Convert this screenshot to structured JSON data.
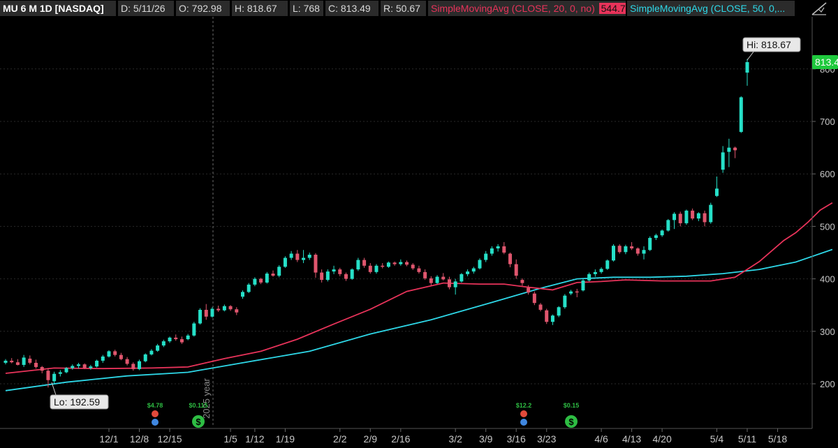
{
  "header": {
    "symbol_label": "MU 6 M 1D [NASDAQ]",
    "date_label": "D: 5/11/26",
    "open_label": "O: 792.98",
    "high_label": "H: 818.67",
    "low_label": "L: 768",
    "close_label": "C: 813.49",
    "rsi_label": "R: 50.67",
    "sma20_label": "SimpleMovingAvg (CLOSE, 20, 0, no)",
    "sma20_value": "544.74",
    "sma50_label": "SimpleMovingAvg (CLOSE, 50, 0,..."
  },
  "colors": {
    "up": "#26e0c8",
    "down": "#e0566e",
    "sma20": "#e8335a",
    "sma50": "#2ed8e8",
    "price_tag": "#1fc93d",
    "grid": "#2a2a2a",
    "axis_text": "#c8c8c8",
    "earnings": "#e24a3b",
    "dividend": "#2ebd43",
    "info": "#3f87e0"
  },
  "chart_data": {
    "type": "candlestick",
    "symbol": "MU",
    "timeframe": "6 M 1D",
    "exchange": "NASDAQ",
    "ylim": [
      160,
      835
    ],
    "y_ticks": [
      200,
      300,
      400,
      500,
      600,
      700,
      800
    ],
    "x_ticks": [
      "12/1",
      "12/8",
      "12/15",
      "1/5",
      "1/12",
      "1/19",
      "2/2",
      "2/9",
      "2/16",
      "3/2",
      "3/9",
      "3/16",
      "3/23",
      "4/6",
      "4/13",
      "4/20",
      "5/4",
      "5/11",
      "5/18"
    ],
    "year_marker": "2025 year",
    "last_price_tag": "813.4",
    "high_label": "Hi: 818.67",
    "low_label": "Lo: 192.59",
    "candles": [
      {
        "o": 240,
        "h": 247,
        "l": 237,
        "c": 244
      },
      {
        "o": 244,
        "h": 249,
        "l": 239,
        "c": 241
      },
      {
        "o": 241,
        "h": 247,
        "l": 235,
        "c": 236
      },
      {
        "o": 236,
        "h": 255,
        "l": 232,
        "c": 250
      },
      {
        "o": 248,
        "h": 254,
        "l": 237,
        "c": 240
      },
      {
        "o": 240,
        "h": 246,
        "l": 229,
        "c": 232
      },
      {
        "o": 232,
        "h": 234,
        "l": 220,
        "c": 225
      },
      {
        "o": 225,
        "h": 230,
        "l": 193,
        "c": 207
      },
      {
        "o": 205,
        "h": 223,
        "l": 199,
        "c": 219
      },
      {
        "o": 219,
        "h": 226,
        "l": 214,
        "c": 222
      },
      {
        "o": 222,
        "h": 232,
        "l": 220,
        "c": 230
      },
      {
        "o": 230,
        "h": 237,
        "l": 227,
        "c": 234
      },
      {
        "o": 234,
        "h": 240,
        "l": 229,
        "c": 237
      },
      {
        "o": 237,
        "h": 239,
        "l": 228,
        "c": 230
      },
      {
        "o": 230,
        "h": 236,
        "l": 227,
        "c": 233
      },
      {
        "o": 233,
        "h": 246,
        "l": 231,
        "c": 244
      },
      {
        "o": 244,
        "h": 255,
        "l": 240,
        "c": 252
      },
      {
        "o": 252,
        "h": 264,
        "l": 250,
        "c": 262
      },
      {
        "o": 262,
        "h": 265,
        "l": 252,
        "c": 255
      },
      {
        "o": 255,
        "h": 259,
        "l": 245,
        "c": 247
      },
      {
        "o": 247,
        "h": 251,
        "l": 235,
        "c": 238
      },
      {
        "o": 238,
        "h": 241,
        "l": 225,
        "c": 228
      },
      {
        "o": 228,
        "h": 246,
        "l": 226,
        "c": 243
      },
      {
        "o": 243,
        "h": 258,
        "l": 241,
        "c": 256
      },
      {
        "o": 256,
        "h": 266,
        "l": 254,
        "c": 263
      },
      {
        "o": 263,
        "h": 276,
        "l": 261,
        "c": 273
      },
      {
        "o": 273,
        "h": 284,
        "l": 270,
        "c": 281
      },
      {
        "o": 281,
        "h": 290,
        "l": 278,
        "c": 288
      },
      {
        "o": 288,
        "h": 294,
        "l": 282,
        "c": 285
      },
      {
        "o": 285,
        "h": 290,
        "l": 276,
        "c": 279
      },
      {
        "o": 285,
        "h": 295,
        "l": 283,
        "c": 292
      },
      {
        "o": 292,
        "h": 318,
        "l": 290,
        "c": 315
      },
      {
        "o": 315,
        "h": 344,
        "l": 313,
        "c": 341
      },
      {
        "o": 341,
        "h": 352,
        "l": 322,
        "c": 328
      },
      {
        "o": 328,
        "h": 346,
        "l": 326,
        "c": 343
      },
      {
        "o": 343,
        "h": 349,
        "l": 337,
        "c": 340
      },
      {
        "o": 340,
        "h": 351,
        "l": 338,
        "c": 348
      },
      {
        "o": 348,
        "h": 350,
        "l": 339,
        "c": 342
      },
      {
        "o": 342,
        "h": 346,
        "l": 331,
        "c": 336
      },
      {
        "o": 366,
        "h": 378,
        "l": 362,
        "c": 375
      },
      {
        "o": 375,
        "h": 392,
        "l": 373,
        "c": 389
      },
      {
        "o": 389,
        "h": 403,
        "l": 386,
        "c": 400
      },
      {
        "o": 400,
        "h": 402,
        "l": 390,
        "c": 393
      },
      {
        "o": 393,
        "h": 413,
        "l": 391,
        "c": 410
      },
      {
        "o": 410,
        "h": 416,
        "l": 404,
        "c": 406
      },
      {
        "o": 406,
        "h": 426,
        "l": 403,
        "c": 423
      },
      {
        "o": 423,
        "h": 443,
        "l": 421,
        "c": 440
      },
      {
        "o": 440,
        "h": 453,
        "l": 436,
        "c": 448
      },
      {
        "o": 448,
        "h": 455,
        "l": 432,
        "c": 436
      },
      {
        "o": 436,
        "h": 455,
        "l": 430,
        "c": 440
      },
      {
        "o": 440,
        "h": 450,
        "l": 436,
        "c": 446
      },
      {
        "o": 446,
        "h": 449,
        "l": 402,
        "c": 412
      },
      {
        "o": 412,
        "h": 418,
        "l": 393,
        "c": 398
      },
      {
        "o": 398,
        "h": 418,
        "l": 395,
        "c": 414
      },
      {
        "o": 414,
        "h": 425,
        "l": 409,
        "c": 418
      },
      {
        "o": 418,
        "h": 421,
        "l": 405,
        "c": 409
      },
      {
        "o": 409,
        "h": 412,
        "l": 396,
        "c": 400
      },
      {
        "o": 400,
        "h": 420,
        "l": 398,
        "c": 418
      },
      {
        "o": 418,
        "h": 440,
        "l": 415,
        "c": 436
      },
      {
        "o": 436,
        "h": 440,
        "l": 421,
        "c": 425
      },
      {
        "o": 425,
        "h": 430,
        "l": 410,
        "c": 413
      },
      {
        "o": 413,
        "h": 428,
        "l": 410,
        "c": 425
      },
      {
        "o": 425,
        "h": 430,
        "l": 420,
        "c": 423
      },
      {
        "o": 423,
        "h": 433,
        "l": 421,
        "c": 431
      },
      {
        "o": 431,
        "h": 433,
        "l": 425,
        "c": 428
      },
      {
        "o": 428,
        "h": 437,
        "l": 425,
        "c": 432
      },
      {
        "o": 432,
        "h": 435,
        "l": 424,
        "c": 427
      },
      {
        "o": 427,
        "h": 430,
        "l": 417,
        "c": 420
      },
      {
        "o": 420,
        "h": 425,
        "l": 410,
        "c": 413
      },
      {
        "o": 413,
        "h": 418,
        "l": 398,
        "c": 401
      },
      {
        "o": 401,
        "h": 405,
        "l": 387,
        "c": 392
      },
      {
        "o": 392,
        "h": 407,
        "l": 390,
        "c": 404
      },
      {
        "o": 404,
        "h": 411,
        "l": 397,
        "c": 399
      },
      {
        "o": 399,
        "h": 404,
        "l": 380,
        "c": 384
      },
      {
        "o": 384,
        "h": 400,
        "l": 370,
        "c": 395
      },
      {
        "o": 395,
        "h": 411,
        "l": 393,
        "c": 409
      },
      {
        "o": 409,
        "h": 418,
        "l": 405,
        "c": 414
      },
      {
        "o": 414,
        "h": 423,
        "l": 410,
        "c": 420
      },
      {
        "o": 420,
        "h": 439,
        "l": 418,
        "c": 436
      },
      {
        "o": 436,
        "h": 453,
        "l": 432,
        "c": 448
      },
      {
        "o": 448,
        "h": 462,
        "l": 444,
        "c": 458
      },
      {
        "o": 458,
        "h": 466,
        "l": 452,
        "c": 462
      },
      {
        "o": 462,
        "h": 470,
        "l": 447,
        "c": 450
      },
      {
        "o": 448,
        "h": 450,
        "l": 422,
        "c": 428
      },
      {
        "o": 428,
        "h": 437,
        "l": 400,
        "c": 406
      },
      {
        "o": 398,
        "h": 401,
        "l": 387,
        "c": 392
      },
      {
        "o": 383,
        "h": 388,
        "l": 370,
        "c": 374
      },
      {
        "o": 372,
        "h": 376,
        "l": 350,
        "c": 354
      },
      {
        "o": 351,
        "h": 354,
        "l": 338,
        "c": 341
      },
      {
        "o": 340,
        "h": 343,
        "l": 314,
        "c": 318
      },
      {
        "o": 318,
        "h": 332,
        "l": 312,
        "c": 330
      },
      {
        "o": 330,
        "h": 348,
        "l": 327,
        "c": 346
      },
      {
        "o": 346,
        "h": 371,
        "l": 343,
        "c": 368
      },
      {
        "o": 372,
        "h": 379,
        "l": 369,
        "c": 376
      },
      {
        "o": 376,
        "h": 381,
        "l": 365,
        "c": 374
      },
      {
        "o": 378,
        "h": 400,
        "l": 376,
        "c": 397
      },
      {
        "o": 397,
        "h": 412,
        "l": 395,
        "c": 409
      },
      {
        "o": 409,
        "h": 418,
        "l": 404,
        "c": 413
      },
      {
        "o": 413,
        "h": 422,
        "l": 410,
        "c": 419
      },
      {
        "o": 419,
        "h": 437,
        "l": 417,
        "c": 435
      },
      {
        "o": 435,
        "h": 466,
        "l": 433,
        "c": 463
      },
      {
        "o": 463,
        "h": 466,
        "l": 448,
        "c": 451
      },
      {
        "o": 451,
        "h": 465,
        "l": 447,
        "c": 462
      },
      {
        "o": 462,
        "h": 470,
        "l": 455,
        "c": 458
      },
      {
        "o": 458,
        "h": 460,
        "l": 444,
        "c": 448
      },
      {
        "o": 448,
        "h": 462,
        "l": 437,
        "c": 455
      },
      {
        "o": 455,
        "h": 481,
        "l": 453,
        "c": 478
      },
      {
        "o": 478,
        "h": 486,
        "l": 474,
        "c": 483
      },
      {
        "o": 483,
        "h": 494,
        "l": 480,
        "c": 492
      },
      {
        "o": 492,
        "h": 514,
        "l": 490,
        "c": 512
      },
      {
        "o": 512,
        "h": 527,
        "l": 495,
        "c": 524
      },
      {
        "o": 524,
        "h": 528,
        "l": 500,
        "c": 506
      },
      {
        "o": 506,
        "h": 532,
        "l": 503,
        "c": 530
      },
      {
        "o": 530,
        "h": 534,
        "l": 512,
        "c": 515
      },
      {
        "o": 515,
        "h": 527,
        "l": 510,
        "c": 525
      },
      {
        "o": 525,
        "h": 530,
        "l": 500,
        "c": 508
      },
      {
        "o": 508,
        "h": 545,
        "l": 505,
        "c": 541
      },
      {
        "o": 558,
        "h": 595,
        "l": 556,
        "c": 572
      },
      {
        "o": 608,
        "h": 653,
        "l": 602,
        "c": 641
      },
      {
        "o": 642,
        "h": 667,
        "l": 613,
        "c": 650
      },
      {
        "o": 650,
        "h": 652,
        "l": 630,
        "c": 645
      },
      {
        "o": 680,
        "h": 748,
        "l": 678,
        "c": 746
      },
      {
        "o": 793,
        "h": 819,
        "l": 768,
        "c": 813
      }
    ],
    "series": [
      {
        "name": "SimpleMovingAvg (CLOSE, 20, 0, no)",
        "type": "line",
        "points": [
          [
            0,
            220
          ],
          [
            8,
            230
          ],
          [
            16,
            229
          ],
          [
            24,
            230
          ],
          [
            30,
            232
          ],
          [
            36,
            248
          ],
          [
            42,
            262
          ],
          [
            48,
            285
          ],
          [
            54,
            314
          ],
          [
            60,
            342
          ],
          [
            66,
            376
          ],
          [
            72,
            392
          ],
          [
            78,
            390
          ],
          [
            82,
            390
          ],
          [
            86,
            384
          ],
          [
            90,
            379
          ],
          [
            94,
            393
          ],
          [
            98,
            395
          ],
          [
            102,
            398
          ],
          [
            108,
            396
          ],
          [
            116,
            396
          ],
          [
            120,
            403
          ],
          [
            124,
            433
          ],
          [
            128,
            473
          ],
          [
            130,
            488
          ],
          [
            132,
            508
          ],
          [
            134,
            531
          ],
          [
            136,
            545
          ]
        ]
      },
      {
        "name": "SimpleMovingAvg (CLOSE, 50, 0,...",
        "type": "line",
        "points": [
          [
            0,
            187
          ],
          [
            10,
            203
          ],
          [
            20,
            215
          ],
          [
            30,
            222
          ],
          [
            40,
            242
          ],
          [
            50,
            262
          ],
          [
            60,
            295
          ],
          [
            70,
            322
          ],
          [
            80,
            355
          ],
          [
            88,
            382
          ],
          [
            94,
            400
          ],
          [
            100,
            403
          ],
          [
            106,
            403
          ],
          [
            112,
            405
          ],
          [
            118,
            410
          ],
          [
            124,
            418
          ],
          [
            130,
            432
          ],
          [
            136,
            456
          ]
        ]
      }
    ],
    "events": [
      {
        "type": "earnings",
        "label": "$4.78"
      },
      {
        "type": "dividend",
        "label": "$0.115"
      },
      {
        "type": "earnings",
        "label": "$12.2"
      },
      {
        "type": "dividend",
        "label": "$0.15"
      }
    ]
  }
}
